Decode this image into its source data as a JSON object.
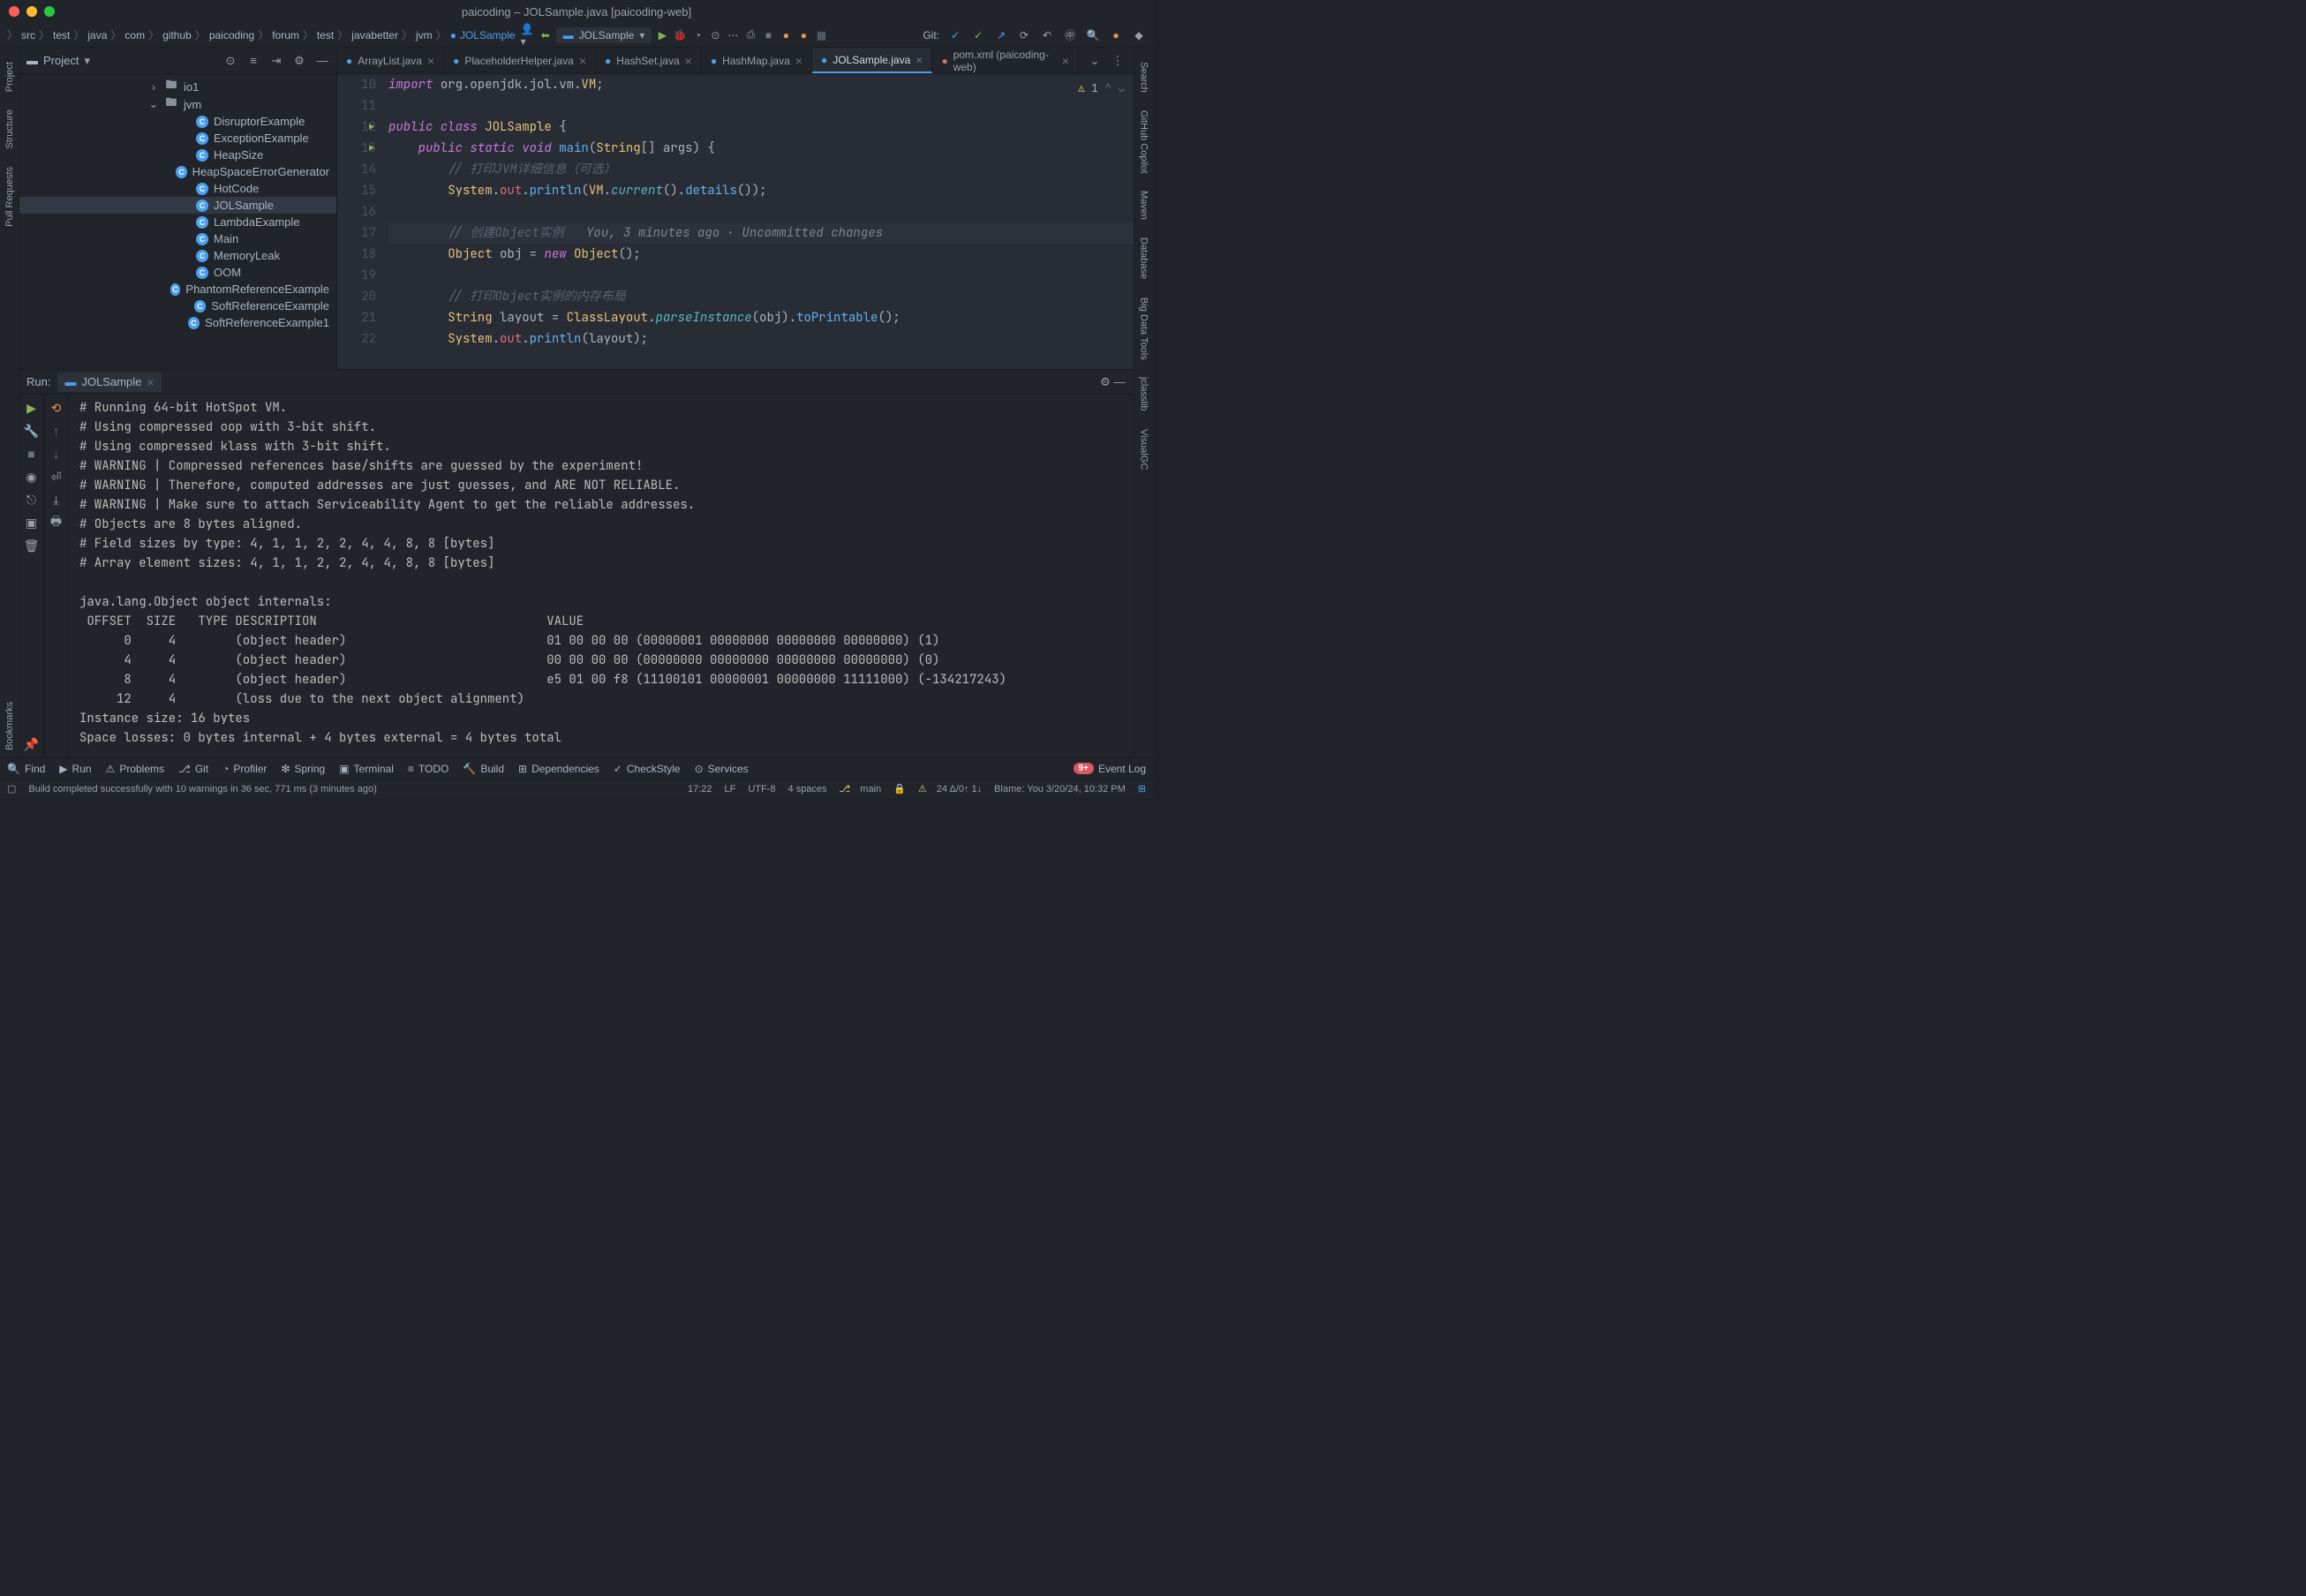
{
  "title": "paicoding – JOLSample.java [paicoding-web]",
  "breadcrumbs": [
    "src",
    "test",
    "java",
    "com",
    "github",
    "paicoding",
    "forum",
    "test",
    "javabetter",
    "jvm",
    "JOLSample"
  ],
  "runConfig": "JOLSample",
  "gitLabel": "Git:",
  "projectPanel": {
    "title": "Project",
    "tree": [
      {
        "indent": 140,
        "chevron": "›",
        "type": "folder",
        "label": "io1"
      },
      {
        "indent": 140,
        "chevron": "⌄",
        "type": "folder",
        "label": "jvm"
      },
      {
        "indent": 176,
        "type": "class",
        "label": "DisruptorExample"
      },
      {
        "indent": 176,
        "type": "class",
        "label": "ExceptionExample"
      },
      {
        "indent": 176,
        "type": "class",
        "label": "HeapSize"
      },
      {
        "indent": 176,
        "type": "class",
        "label": "HeapSpaceErrorGenerator"
      },
      {
        "indent": 176,
        "type": "class",
        "label": "HotCode"
      },
      {
        "indent": 176,
        "type": "class",
        "label": "JOLSample",
        "selected": true
      },
      {
        "indent": 176,
        "type": "class",
        "label": "LambdaExample"
      },
      {
        "indent": 176,
        "type": "class",
        "label": "Main"
      },
      {
        "indent": 176,
        "type": "class",
        "label": "MemoryLeak"
      },
      {
        "indent": 176,
        "type": "class",
        "label": "OOM"
      },
      {
        "indent": 176,
        "type": "class",
        "label": "PhantomReferenceExample"
      },
      {
        "indent": 176,
        "type": "class",
        "label": "SoftReferenceExample"
      },
      {
        "indent": 176,
        "type": "class",
        "label": "SoftReferenceExample1"
      }
    ]
  },
  "tabs": [
    {
      "label": "ArrayList.java",
      "icon": "java"
    },
    {
      "label": "PlaceholderHelper.java",
      "icon": "java"
    },
    {
      "label": "HashSet.java",
      "icon": "java"
    },
    {
      "label": "HashMap.java",
      "icon": "java"
    },
    {
      "label": "JOLSample.java",
      "icon": "java",
      "active": true
    },
    {
      "label": "pom.xml (paicoding-web)",
      "icon": "maven"
    }
  ],
  "inspection": {
    "warnings": "1"
  },
  "codeLines": [
    {
      "n": 10,
      "html": "<span class='kw'>import</span> <span class='pn'>org.openjdk.jol.vm.</span><span class='cls'>VM</span><span class='pn'>;</span>"
    },
    {
      "n": 11,
      "html": ""
    },
    {
      "n": 12,
      "run": true,
      "html": "<span class='kw'>public class</span> <span class='cls'>JOLSample</span> <span class='pn'>{</span>"
    },
    {
      "n": 13,
      "run": true,
      "html": "    <span class='kw'>public static</span> <span class='kw'>void</span> <span class='mth'>main</span><span class='pn'>(</span><span class='cls'>String</span><span class='pn'>[] args) {</span>"
    },
    {
      "n": 14,
      "html": "        <span class='cmt'>// 打印JVM详细信息（可选）</span>"
    },
    {
      "n": 15,
      "html": "        <span class='cls'>System</span><span class='pn'>.</span><span class='var'>out</span><span class='pn'>.</span><span class='mth'>println</span><span class='pn'>(</span><span class='cls'>VM</span><span class='pn'>.</span><span class='fn'>current</span><span class='pn'>().</span><span class='mth'>details</span><span class='pn'>());</span>"
    },
    {
      "n": 16,
      "html": ""
    },
    {
      "n": 17,
      "hl": true,
      "html": "        <span class='cmt'>// 创建Object实例</span>   <span class='cmt2'>You, 3 minutes ago · Uncommitted changes</span>"
    },
    {
      "n": 18,
      "html": "        <span class='cls'>Object</span> <span class='pn'>obj</span> <span class='op'>=</span> <span class='kw'>new</span> <span class='cls'>Object</span><span class='pn'>();</span>"
    },
    {
      "n": 19,
      "html": ""
    },
    {
      "n": 20,
      "html": "        <span class='cmt'>// 打印Object实例的内存布局</span>"
    },
    {
      "n": 21,
      "html": "        <span class='cls'>String</span> <span class='pn'>layout</span> <span class='op'>=</span> <span class='cls'>ClassLayout</span><span class='pn'>.</span><span class='fn'>parseInstance</span><span class='pn'>(obj).</span><span class='mth'>toPrintable</span><span class='pn'>();</span>"
    },
    {
      "n": 22,
      "html": "        <span class='cls'>System</span><span class='pn'>.</span><span class='var'>out</span><span class='pn'>.</span><span class='mth'>println</span><span class='pn'>(layout);</span>"
    }
  ],
  "run": {
    "label": "Run:",
    "tab": "JOLSample",
    "console": "# Running 64-bit HotSpot VM.\n# Using compressed oop with 3-bit shift.\n# Using compressed klass with 3-bit shift.\n# WARNING | Compressed references base/shifts are guessed by the experiment!\n# WARNING | Therefore, computed addresses are just guesses, and ARE NOT RELIABLE.\n# WARNING | Make sure to attach Serviceability Agent to get the reliable addresses.\n# Objects are 8 bytes aligned.\n# Field sizes by type: 4, 1, 1, 2, 2, 4, 4, 8, 8 [bytes]\n# Array element sizes: 4, 1, 1, 2, 2, 4, 4, 8, 8 [bytes]\n\njava.lang.Object object internals:\n OFFSET  SIZE   TYPE DESCRIPTION                               VALUE\n      0     4        (object header)                           01 00 00 00 (00000001 00000000 00000000 00000000) (1)\n      4     4        (object header)                           00 00 00 00 (00000000 00000000 00000000 00000000) (0)\n      8     4        (object header)                           e5 01 00 f8 (11100101 00000001 00000000 11111000) (-134217243)\n     12     4        (loss due to the next object alignment)\nInstance size: 16 bytes\nSpace losses: 0 bytes internal + 4 bytes external = 4 bytes total\n"
  },
  "leftGutter": [
    "Project",
    "Structure",
    "Pull Requests"
  ],
  "leftGutterBottom": [
    "Bookmarks"
  ],
  "rightGutter": [
    "Search",
    "GitHub Copilot",
    "Maven",
    "Database",
    "Big Data Tools",
    "jclasslib",
    "VisualGC"
  ],
  "bottomToolbar": {
    "items": [
      "Find",
      "Run",
      "Problems",
      "Git",
      "Profiler",
      "Spring",
      "Terminal",
      "TODO",
      "Build",
      "Dependencies",
      "CheckStyle",
      "Services"
    ],
    "eventLogBadge": "9+",
    "eventLog": "Event Log"
  },
  "statusBar": {
    "message": "Build completed successfully with 10 warnings in 36 sec, 771 ms (3 minutes ago)",
    "caret": "17:22",
    "lineSep": "LF",
    "encoding": "UTF-8",
    "indent": "4 spaces",
    "branch": "main",
    "diff": "24 Δ/0↑ 1↓",
    "blame": "Blame: You 3/20/24, 10:32 PM"
  }
}
